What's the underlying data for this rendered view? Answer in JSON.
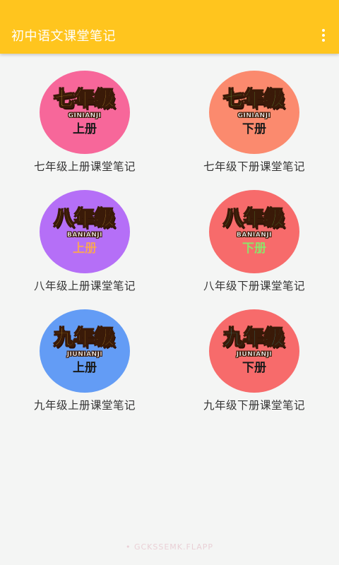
{
  "appbar": {
    "title": "初中语文课堂笔记",
    "menu_icon": "more-vert-icon"
  },
  "items": [
    {
      "badge_title": "七年级",
      "badge_sub": "GINIANJI",
      "badge_vol": "上册",
      "label": "七年级上册课堂笔记",
      "circle_color": "#f7679a",
      "title_color": "#ffd24a",
      "vol_color": "#1a1a1a"
    },
    {
      "badge_title": "七年级",
      "badge_sub": "GINIANJI",
      "badge_vol": "下册",
      "label": "七年级下册课堂笔记",
      "circle_color": "#fb8a6e",
      "title_color": "#7bdc55",
      "vol_color": "#1a1a1a"
    },
    {
      "badge_title": "八年级",
      "badge_sub": "BANIANJI",
      "badge_vol": "上册",
      "label": "八年级上册课堂笔记",
      "circle_color": "#b56ff7",
      "title_color": "#ffd24a",
      "vol_color": "#f6a45d"
    },
    {
      "badge_title": "八年级",
      "badge_sub": "BANIANJI",
      "badge_vol": "下册",
      "label": "八年级下册课堂笔记",
      "circle_color": "#f76b6b",
      "title_color": "#63d957",
      "vol_color": "#8fe36a"
    },
    {
      "badge_title": "九年级",
      "badge_sub": "JIUNIANJI",
      "badge_vol": "上册",
      "label": "九年级上册课堂笔记",
      "circle_color": "#639cf5",
      "title_color": "#ffcf3f",
      "vol_color": "#1a1a1a"
    },
    {
      "badge_title": "九年级",
      "badge_sub": "JIUNIANJI",
      "badge_vol": "下册",
      "label": "九年级下册课堂笔记",
      "circle_color": "#f76b6b",
      "title_color": "#3ec9c3",
      "vol_color": "#1a1a1a"
    }
  ],
  "footer": {
    "text": "• GCKSSEMK.FLAPP"
  }
}
